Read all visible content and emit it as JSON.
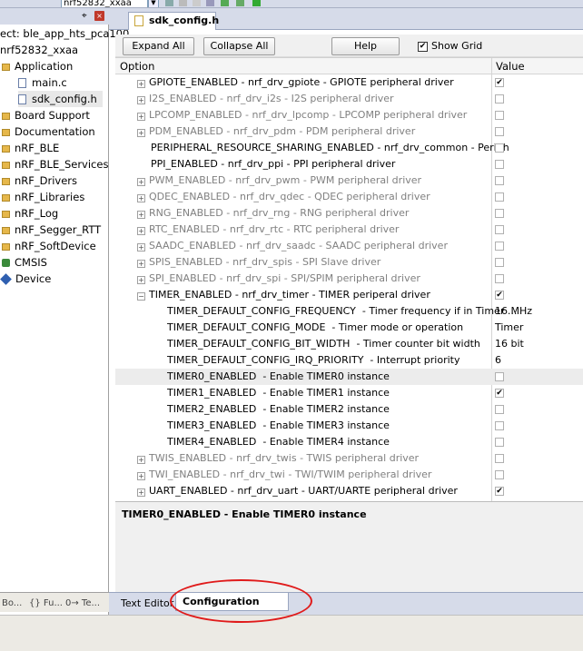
{
  "topbar": {
    "target_combo": "nrf52832_xxaa"
  },
  "left_panel": {
    "pin_glyph": "⌖",
    "close_glyph": "×",
    "tree": [
      {
        "label": "ect: ble_app_hts_pca100",
        "icon": "none"
      },
      {
        "label": "nrf52832_xxaa",
        "icon": "none"
      },
      {
        "label": "Application",
        "icon": "folder"
      },
      {
        "label": "main.c",
        "icon": "file"
      },
      {
        "label": "sdk_config.h",
        "icon": "file"
      },
      {
        "label": "Board Support",
        "icon": "folder"
      },
      {
        "label": "Documentation",
        "icon": "folder"
      },
      {
        "label": "nRF_BLE",
        "icon": "folder"
      },
      {
        "label": "nRF_BLE_Services",
        "icon": "folder"
      },
      {
        "label": "nRF_Drivers",
        "icon": "folder"
      },
      {
        "label": "nRF_Libraries",
        "icon": "folder"
      },
      {
        "label": "nRF_Log",
        "icon": "folder"
      },
      {
        "label": "nRF_Segger_RTT",
        "icon": "folder"
      },
      {
        "label": "nRF_SoftDevice",
        "icon": "folder"
      },
      {
        "label": "CMSIS",
        "icon": "cube"
      },
      {
        "label": "Device",
        "icon": "diamond"
      }
    ],
    "tabs": [
      "Bo...",
      "{} Fu...",
      "0→ Te..."
    ]
  },
  "editor": {
    "doc_tab": "sdk_config.h",
    "toolbar": {
      "expand_all": "Expand All",
      "collapse_all": "Collapse All",
      "help": "Help",
      "show_grid_label": "Show Grid",
      "show_grid_check": "✔"
    },
    "grid": {
      "col_option": "Option",
      "col_value": "Value",
      "rows": [
        {
          "name": "GPIOTE_ENABLED",
          "desc": "nrf_drv_gpiote - GPIOTE peripheral driver",
          "exp": "+",
          "dim": false,
          "type": "check",
          "value": "✔"
        },
        {
          "name": "I2S_ENABLED",
          "desc": "nrf_drv_i2s - I2S peripheral driver",
          "exp": "+",
          "dim": true,
          "type": "check",
          "value": ""
        },
        {
          "name": "LPCOMP_ENABLED",
          "desc": "nrf_drv_lpcomp - LPCOMP peripheral driver",
          "exp": "+",
          "dim": true,
          "type": "check",
          "value": ""
        },
        {
          "name": "PDM_ENABLED",
          "desc": "nrf_drv_pdm - PDM peripheral driver",
          "exp": "+",
          "dim": true,
          "type": "check",
          "value": ""
        },
        {
          "name": "PERIPHERAL_RESOURCE_SHARING_ENABLED",
          "desc": "nrf_drv_common - Periph...",
          "exp": "",
          "dim": false,
          "type": "check",
          "value": ""
        },
        {
          "name": "PPI_ENABLED",
          "desc": "nrf_drv_ppi - PPI peripheral driver",
          "exp": "",
          "dim": false,
          "type": "check",
          "value": ""
        },
        {
          "name": "PWM_ENABLED",
          "desc": "nrf_drv_pwm - PWM peripheral driver",
          "exp": "+",
          "dim": true,
          "type": "check",
          "value": ""
        },
        {
          "name": "QDEC_ENABLED",
          "desc": "nrf_drv_qdec - QDEC peripheral driver",
          "exp": "+",
          "dim": true,
          "type": "check",
          "value": ""
        },
        {
          "name": "RNG_ENABLED",
          "desc": "nrf_drv_rng - RNG peripheral driver",
          "exp": "+",
          "dim": true,
          "type": "check",
          "value": ""
        },
        {
          "name": "RTC_ENABLED",
          "desc": "nrf_drv_rtc - RTC peripheral driver",
          "exp": "+",
          "dim": true,
          "type": "check",
          "value": ""
        },
        {
          "name": "SAADC_ENABLED",
          "desc": "nrf_drv_saadc - SAADC peripheral driver",
          "exp": "+",
          "dim": true,
          "type": "check",
          "value": ""
        },
        {
          "name": "SPIS_ENABLED",
          "desc": "nrf_drv_spis - SPI Slave driver",
          "exp": "+",
          "dim": true,
          "type": "check",
          "value": ""
        },
        {
          "name": "SPI_ENABLED",
          "desc": "nrf_drv_spi - SPI/SPIM peripheral driver",
          "exp": "+",
          "dim": true,
          "type": "check",
          "value": ""
        },
        {
          "name": "TIMER_ENABLED",
          "desc": "nrf_drv_timer - TIMER periperal driver",
          "exp": "−",
          "dim": false,
          "type": "check",
          "value": "✔"
        },
        {
          "name": "TIMER_DEFAULT_CONFIG_FREQUENCY",
          "desc": "Timer frequency if in Timer ...",
          "exp": "",
          "dim": false,
          "type": "text",
          "value": "16 MHz",
          "child": true
        },
        {
          "name": "TIMER_DEFAULT_CONFIG_MODE",
          "desc": "Timer mode or operation",
          "exp": "",
          "dim": false,
          "type": "text",
          "value": "Timer",
          "child": true
        },
        {
          "name": "TIMER_DEFAULT_CONFIG_BIT_WIDTH",
          "desc": "Timer counter bit width",
          "exp": "",
          "dim": false,
          "type": "text",
          "value": "16 bit",
          "child": true
        },
        {
          "name": "TIMER_DEFAULT_CONFIG_IRQ_PRIORITY",
          "desc": "Interrupt priority",
          "exp": "",
          "dim": false,
          "type": "text",
          "value": "6",
          "child": true
        },
        {
          "name": "TIMER0_ENABLED",
          "desc": "Enable TIMER0 instance",
          "exp": "",
          "dim": false,
          "type": "check",
          "value": "",
          "child": true,
          "highlight": true
        },
        {
          "name": "TIMER1_ENABLED",
          "desc": "Enable TIMER1 instance",
          "exp": "",
          "dim": false,
          "type": "check",
          "value": "✔",
          "child": true
        },
        {
          "name": "TIMER2_ENABLED",
          "desc": "Enable TIMER2 instance",
          "exp": "",
          "dim": false,
          "type": "check",
          "value": "",
          "child": true
        },
        {
          "name": "TIMER3_ENABLED",
          "desc": "Enable TIMER3 instance",
          "exp": "",
          "dim": false,
          "type": "check",
          "value": "",
          "child": true
        },
        {
          "name": "TIMER4_ENABLED",
          "desc": "Enable TIMER4 instance",
          "exp": "",
          "dim": false,
          "type": "check",
          "value": "",
          "child": true
        },
        {
          "name": "TWIS_ENABLED",
          "desc": "nrf_drv_twis - TWIS peripheral driver",
          "exp": "+",
          "dim": true,
          "type": "check",
          "value": ""
        },
        {
          "name": "TWI_ENABLED",
          "desc": "nrf_drv_twi - TWI/TWIM peripheral driver",
          "exp": "+",
          "dim": true,
          "type": "check",
          "value": ""
        },
        {
          "name": "UART_ENABLED",
          "desc": "nrf_drv_uart - UART/UARTE peripheral driver",
          "exp": "+",
          "dim": false,
          "type": "check",
          "value": "✔"
        }
      ]
    },
    "description": "TIMER0_ENABLED  - Enable TIMER0 instance",
    "bottom_tabs": {
      "text_editor": "Text Editor",
      "config_wizard": "Configuration Wizard"
    }
  },
  "colors": {
    "annotation": "#e01b1b",
    "disabled_text": "#808080"
  }
}
